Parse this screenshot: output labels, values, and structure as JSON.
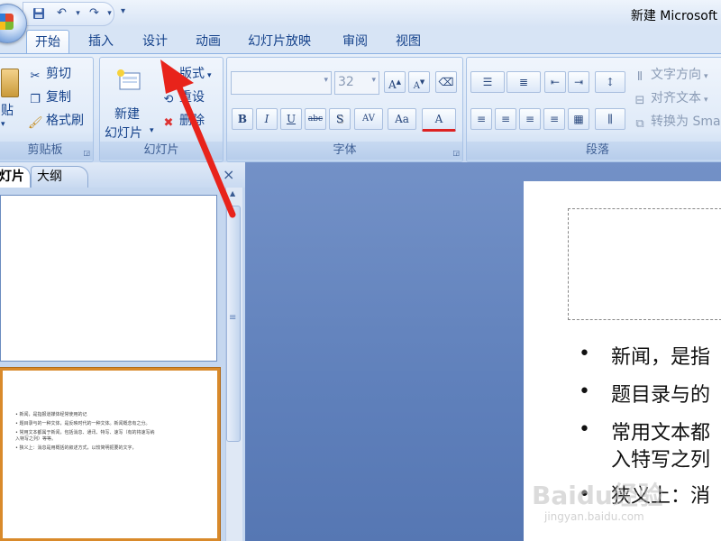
{
  "window": {
    "title": "新建 Microsoft"
  },
  "quick_access": {
    "icons": [
      "save-icon",
      "undo-icon",
      "redo-icon"
    ],
    "more": "▾"
  },
  "tabs": [
    {
      "label": "开始",
      "active": true
    },
    {
      "label": "插入"
    },
    {
      "label": "设计"
    },
    {
      "label": "动画"
    },
    {
      "label": "幻灯片放映"
    },
    {
      "label": "审阅"
    },
    {
      "label": "视图"
    }
  ],
  "ribbon": {
    "clipboard": {
      "label": "剪贴板",
      "paste": "贴",
      "cut": "剪切",
      "copy": "复制",
      "format_painter": "格式刷"
    },
    "slides": {
      "label": "幻灯片",
      "new_slide_line1": "新建",
      "new_slide_line2": "幻灯片",
      "layout": "版式",
      "reset": "重设",
      "delete": "删除"
    },
    "font": {
      "label": "字体",
      "font_name": "",
      "font_size": "32",
      "buttons": [
        "B",
        "I",
        "U",
        "abc",
        "S",
        "AV",
        "Aa",
        "A"
      ]
    },
    "paragraph": {
      "label": "段落",
      "text_direction": "文字方向",
      "align_text": "对齐文本",
      "convert": "转换为 Sma"
    }
  },
  "left_panel": {
    "tabs": [
      "灯片",
      "大纲"
    ],
    "close": "×",
    "scroll_grip": "≡",
    "thumbnail2_lines": [
      "•  新闻，是指报道媒体经常使用的记",
      "•  题目录与的一种文体，是反映时代的一种文体。新闻概念有之分。",
      "•  常用文本都属于新闻，包括消息、通讯、特写、速写（有的将速写纳",
      "    入特写之列）等等。",
      "•  狭义上：消息是用概括的叙述方式，以较简明扼要的文字，"
    ]
  },
  "slide": {
    "bullet": "•",
    "bullets": [
      "新闻，是指",
      "题目录与的",
      "常用文本都",
      "入特写之列",
      "狭义上：消"
    ]
  },
  "watermark": {
    "text": "Baidu经验",
    "sub": "jingyan.baidu.com"
  },
  "colors": {
    "annotation_arrow": "#e8231b",
    "thumbnail_selected": "#d98a2b"
  }
}
